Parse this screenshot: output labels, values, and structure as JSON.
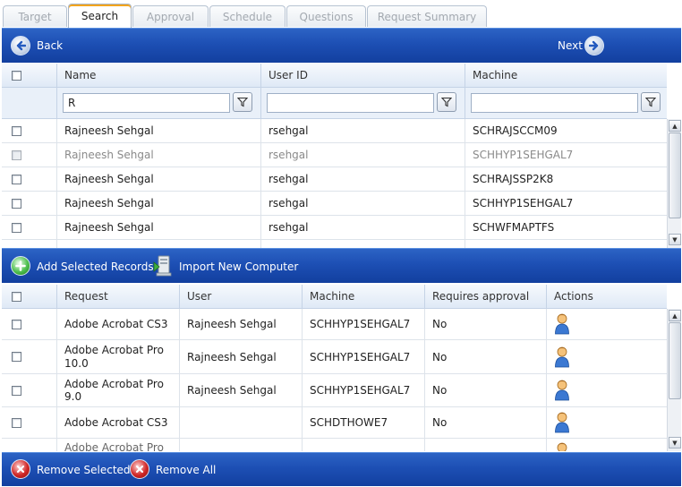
{
  "tabs": [
    {
      "label": "Target",
      "active": false
    },
    {
      "label": "Search",
      "active": true
    },
    {
      "label": "Approval",
      "active": false
    },
    {
      "label": "Schedule",
      "active": false
    },
    {
      "label": "Questions",
      "active": false
    },
    {
      "label": "Request Summary",
      "active": false
    }
  ],
  "nav": {
    "back_label": "Back",
    "next_label": "Next"
  },
  "search_grid": {
    "columns": [
      "Name",
      "User ID",
      "Machine"
    ],
    "filters": {
      "name": "R",
      "user_id": "",
      "machine": ""
    },
    "rows": [
      {
        "name": "Rajneesh Sehgal",
        "user_id": "rsehgal",
        "machine": "SCHRAJSCCM09",
        "disabled": false
      },
      {
        "name": "Rajneesh Sehgal",
        "user_id": "rsehgal",
        "machine": "SCHHYP1SEHGAL7",
        "disabled": true
      },
      {
        "name": "Rajneesh Sehgal",
        "user_id": "rsehgal",
        "machine": "SCHRAJSSP2K8",
        "disabled": false
      },
      {
        "name": "Rajneesh Sehgal",
        "user_id": "rsehgal",
        "machine": "SCHHYP1SEHGAL7",
        "disabled": false
      },
      {
        "name": "Rajneesh Sehgal",
        "user_id": "rsehgal",
        "machine": "SCHWFMAPTFS",
        "disabled": false
      }
    ]
  },
  "mid_toolbar": {
    "add_label": "Add Selected Records",
    "import_label": "Import New Computer"
  },
  "request_grid": {
    "columns": [
      "Request",
      "User",
      "Machine",
      "Requires approval",
      "Actions"
    ],
    "rows": [
      {
        "request": "Adobe Acrobat CS3",
        "user": "Rajneesh Sehgal",
        "machine": "SCHHYP1SEHGAL7",
        "approval": "No"
      },
      {
        "request": "Adobe Acrobat Pro 10.0",
        "user": "Rajneesh Sehgal",
        "machine": "SCHHYP1SEHGAL7",
        "approval": "No"
      },
      {
        "request": "Adobe Acrobat Pro 9.0",
        "user": "Rajneesh Sehgal",
        "machine": "SCHHYP1SEHGAL7",
        "approval": "No"
      },
      {
        "request": "Adobe Acrobat CS3",
        "user": "",
        "machine": "SCHDTHOWE7",
        "approval": "No"
      },
      {
        "request": "Adobe Acrobat Pro",
        "user": "",
        "machine": "",
        "approval": ""
      }
    ]
  },
  "bottom_toolbar": {
    "remove_selected_label": "Remove Selected",
    "remove_all_label": "Remove All"
  },
  "icons": {
    "back": "arrow-left-icon",
    "next": "arrow-right-icon",
    "filter": "filter-icon",
    "add": "plus-circle-icon",
    "import": "computer-import-icon",
    "remove": "x-circle-icon",
    "action": "user-icon"
  },
  "colors": {
    "bar_blue": "#1d4fb4",
    "tab_accent": "#f3a41c",
    "header_bg": "#dfe9f6"
  }
}
